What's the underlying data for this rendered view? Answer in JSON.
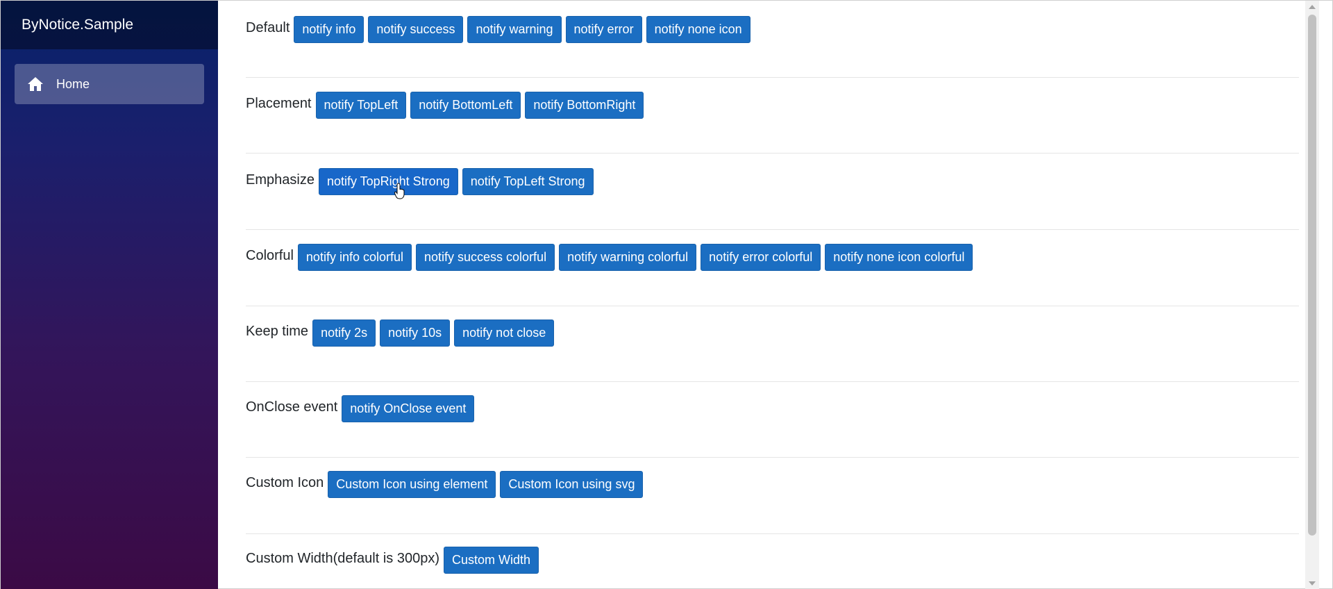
{
  "sidebar": {
    "brand": "ByNotice.Sample",
    "items": [
      {
        "label": "Home",
        "icon": "home-icon",
        "active": true
      }
    ]
  },
  "sections": [
    {
      "label": "Default",
      "buttons": [
        "notify info",
        "notify success",
        "notify warning",
        "notify error",
        "notify none icon"
      ]
    },
    {
      "label": "Placement",
      "buttons": [
        "notify TopLeft",
        "notify BottomLeft",
        "notify BottomRight"
      ]
    },
    {
      "label": "Emphasize",
      "buttons": [
        "notify TopRight Strong",
        "notify TopLeft Strong"
      ]
    },
    {
      "label": "Colorful",
      "buttons": [
        "notify info colorful",
        "notify success colorful",
        "notify warning colorful",
        "notify error colorful",
        "notify none icon colorful"
      ]
    },
    {
      "label": "Keep time",
      "buttons": [
        "notify 2s",
        "notify 10s",
        "notify not close"
      ]
    },
    {
      "label": "OnClose event",
      "buttons": [
        "notify OnClose event"
      ]
    },
    {
      "label": "Custom Icon",
      "buttons": [
        "Custom Icon using element",
        "Custom Icon using svg"
      ]
    },
    {
      "label": "Custom Width(default is 300px)",
      "buttons": [
        "Custom Width"
      ]
    }
  ],
  "colors": {
    "button": "#1b6ec2",
    "button_border": "#1861ac",
    "sidebar_top": "#06226a",
    "sidebar_bottom": "#3b0a45"
  }
}
